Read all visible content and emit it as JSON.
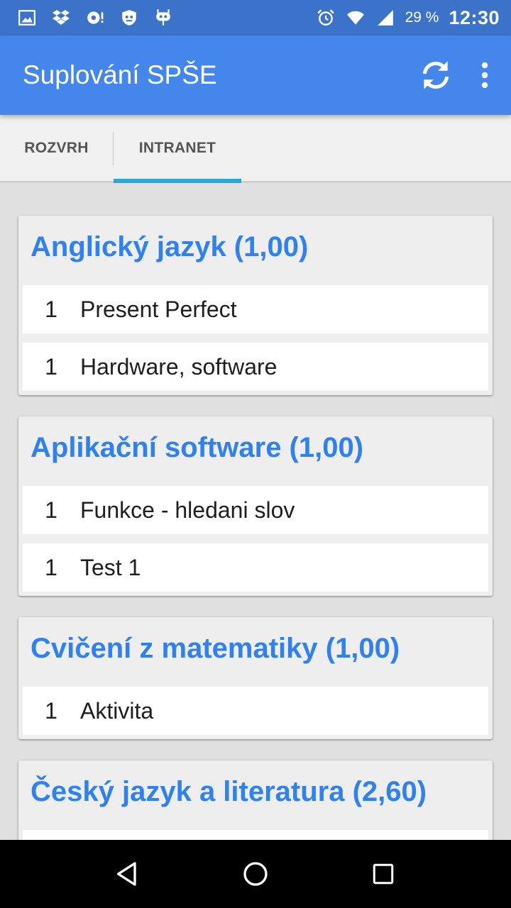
{
  "status_bar": {
    "battery_percent": "29 %",
    "time": "12:30",
    "icons": [
      "gallery-icon",
      "dropbox-icon",
      "app-notification-icon",
      "shield-icon",
      "cyanogen-icon",
      "alarm-icon",
      "wifi-icon",
      "signal-icon"
    ]
  },
  "app_bar": {
    "title": "Suplování SPŠE",
    "actions": [
      "refresh-icon",
      "overflow-menu-icon"
    ]
  },
  "tabs": [
    {
      "label": "ROZVRH",
      "selected": false
    },
    {
      "label": "INTRANET",
      "selected": true
    }
  ],
  "colors": {
    "status_bar": "#3a73c9",
    "app_bar": "#4586ec",
    "tab_indicator": "#2ba6dc",
    "card_title": "#2f80f0"
  },
  "subjects": [
    {
      "title": "Anglický jazyk (1,00)",
      "grades": [
        {
          "grade": "1",
          "topic": "Present Perfect"
        },
        {
          "grade": "1",
          "topic": "Hardware, software"
        }
      ]
    },
    {
      "title": "Aplikační software (1,00)",
      "grades": [
        {
          "grade": "1",
          "topic": "Funkce - hledani slov"
        },
        {
          "grade": "1",
          "topic": "Test 1"
        }
      ]
    },
    {
      "title": "Cvičení z matematiky (1,00)",
      "grades": [
        {
          "grade": "1",
          "topic": "Aktivita"
        }
      ]
    },
    {
      "title": "Český jazyk a literatura (2,60)",
      "grades": [
        {
          "grade": "",
          "topic": ""
        }
      ]
    }
  ],
  "nav_bar": [
    "back-icon",
    "home-icon",
    "recents-icon"
  ]
}
